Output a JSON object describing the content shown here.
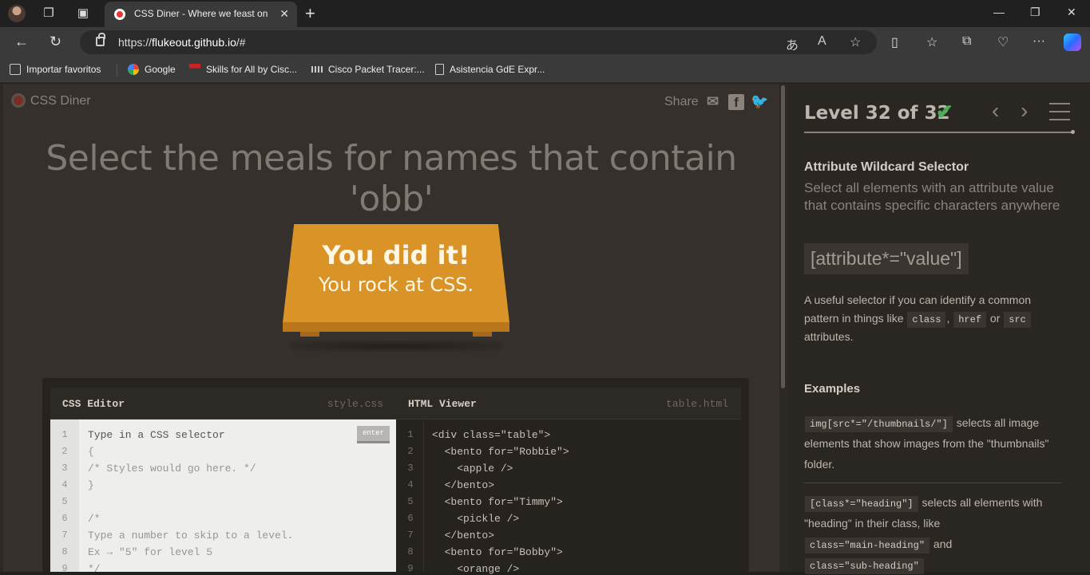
{
  "browser": {
    "tab_title": "CSS Diner - Where we feast on CSS",
    "url_scheme": "https://",
    "url_host": "flukeout.github.io",
    "url_path": "/#",
    "bookmarks": [
      "Importar favoritos",
      "Google",
      "Skills for All by Cisc...",
      "Cisco Packet Tracer:...",
      "Asistencia GdE Expr..."
    ]
  },
  "site": {
    "logo": "CSS Diner",
    "share": "Share"
  },
  "main": {
    "heading": "Select the meals for names that contain 'obb'",
    "win_line1": "You did it!",
    "win_line2": "You rock at CSS."
  },
  "editor": {
    "css_title": "CSS Editor",
    "css_file": "style.css",
    "html_title": "HTML Viewer",
    "html_file": "table.html",
    "enter": "enter",
    "css_lines": [
      {
        "n": "1",
        "t": "Type in a CSS selector"
      },
      {
        "n": "2",
        "t": "{"
      },
      {
        "n": "3",
        "t": "/* Styles would go here. */"
      },
      {
        "n": "4",
        "t": "}"
      },
      {
        "n": "5",
        "t": ""
      },
      {
        "n": "6",
        "t": "/*"
      },
      {
        "n": "7",
        "t": "Type a number to skip to a level."
      },
      {
        "n": "8",
        "t": "Ex → \"5\" for level 5"
      },
      {
        "n": "9",
        "t": "*/"
      }
    ],
    "html_lines": [
      {
        "n": "1",
        "t": "<div class=\"table\">"
      },
      {
        "n": "2",
        "t": "  <bento for=\"Robbie\">"
      },
      {
        "n": "3",
        "t": "    <apple />"
      },
      {
        "n": "4",
        "t": "  </bento>"
      },
      {
        "n": "5",
        "t": "  <bento for=\"Timmy\">"
      },
      {
        "n": "6",
        "t": "    <pickle />"
      },
      {
        "n": "7",
        "t": "  </bento>"
      },
      {
        "n": "8",
        "t": "  <bento for=\"Bobby\">"
      },
      {
        "n": "9",
        "t": "    <orange />"
      }
    ]
  },
  "sidebar": {
    "level": "Level 32 of 32",
    "progress": 1.0,
    "title": "Attribute Wildcard Selector",
    "description": "Select all elements with an attribute value that contains specific characters anywhere",
    "syntax": "[attribute*=\"value\"]",
    "help_1": "A useful selector if you can identify a common pattern in things like",
    "help_kw1": "class",
    "help_sep": ",",
    "help_kw2": "href",
    "help_or": "or",
    "help_kw3": "src",
    "help_2": "attributes.",
    "examples_title": "Examples",
    "ex1_code": "img[src*=\"/thumbnails/\"]",
    "ex1_text": "selects all image elements that show images from the \"thumbnails\" folder.",
    "ex2_code": "[class*=\"heading\"]",
    "ex2_text": "selects all elements with \"heading\" in their class, like",
    "ex2_kw1": "class=\"main-heading\"",
    "ex2_and": "and",
    "ex2_kw2": "class=\"sub-heading\""
  },
  "colors": {
    "accent_plate": "#d99327",
    "check": "#4cae55"
  }
}
